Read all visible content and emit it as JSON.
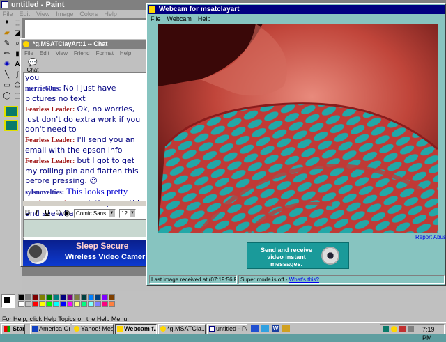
{
  "paint": {
    "title": "untitled - Paint",
    "menu": [
      "File",
      "Edit",
      "View",
      "Image",
      "Colors",
      "Help"
    ],
    "status": "For Help, click Help Topics on the Help Menu."
  },
  "chat": {
    "title": "*g.MSATClayArt:1 -- Chat",
    "menu": [
      "File",
      "Edit",
      "View",
      "Friend",
      "Format",
      "Help"
    ],
    "tab_label": "Chat",
    "font_name": "Comic Sans MS",
    "font_size": "12",
    "messages": [
      {
        "sender": "",
        "text": "you"
      },
      {
        "sender": "merrie60us:",
        "text": "No I just have pictures no text"
      },
      {
        "sender": "Fearless Leader:",
        "text": "Ok, no worries, just don't do extra work if you don't need to"
      },
      {
        "sender": "Fearless Leader:",
        "text": "I'll send you an email with the epson info"
      },
      {
        "sender": "Fearless Leader:",
        "text": "but I got to get my rolling pin and flatten this before pressing. ☺"
      },
      {
        "sender": "sylsnovelties:",
        "text": "This looks pretty"
      },
      {
        "sender": "Fearless Leader:",
        "text": "so let's press this and see what we made"
      }
    ],
    "ad_line1": "Sleep Secure",
    "ad_line2": "Wireless Video Camer"
  },
  "webcam": {
    "title": "Webcam for msatclayart",
    "menu": [
      "File",
      "Webcam",
      "Help"
    ],
    "report_abuse": "Report Abuse",
    "ad_text": "Send and receive video instant messages.",
    "last_image": "Last image received at (07:19:56 PM)",
    "super_mode": "Super mode is off - ",
    "whats_this": "What's this?"
  },
  "taskbar": {
    "start": "Start",
    "buttons": [
      "America Onli...",
      "Yahoo! Mess...",
      "Webcam f...",
      "*g.MSATCla...",
      "untitled - Paint"
    ],
    "clock": "7:19 PM"
  },
  "colors": {
    "titlebar": "#000080",
    "desktop": "#5f9ea0",
    "palette": [
      "#000000",
      "#808080",
      "#800000",
      "#808000",
      "#008000",
      "#008080",
      "#000080",
      "#800080",
      "#808040",
      "#004040",
      "#0080ff",
      "#004080",
      "#8000ff",
      "#804000",
      "#ffffff",
      "#c0c0c0",
      "#ff0000",
      "#ffff00",
      "#00ff00",
      "#00ffff",
      "#0000ff",
      "#ff00ff",
      "#ffff80",
      "#00ff80",
      "#80ffff",
      "#8080ff",
      "#ff0080",
      "#ff8040"
    ]
  }
}
